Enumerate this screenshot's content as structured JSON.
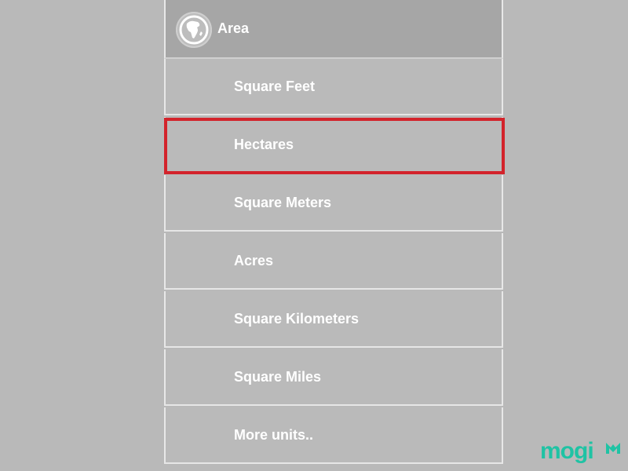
{
  "menu": {
    "header": {
      "label": "Area",
      "icon": "globe-africa-icon"
    },
    "items": [
      {
        "label": "Square Feet"
      },
      {
        "label": "Hectares",
        "selected": true
      },
      {
        "label": "Square Meters"
      },
      {
        "label": "Acres"
      },
      {
        "label": "Square Kilometers"
      },
      {
        "label": "Square Miles"
      },
      {
        "label": "More units.."
      }
    ]
  },
  "watermark": {
    "text": "mogi"
  },
  "colors": {
    "background": "#b9b9b9",
    "header_bg": "#a6a6a6",
    "item_bg": "#bababa",
    "highlight": "#d3232b",
    "logo": "#1fc3a4"
  }
}
